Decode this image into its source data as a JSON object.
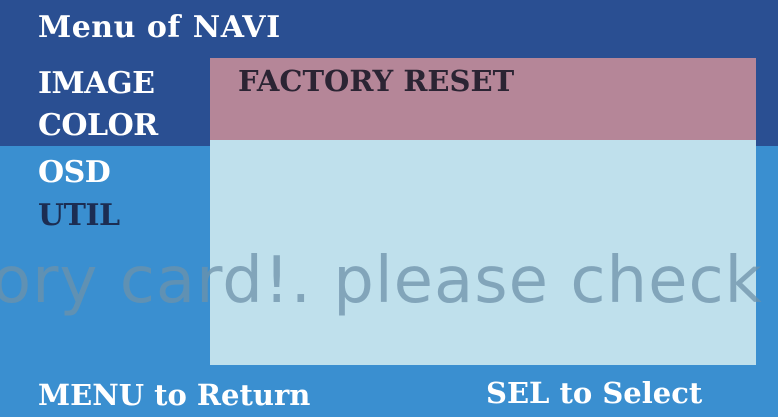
{
  "osd": {
    "title_prefix": "Menu of",
    "title_value": "NAVI",
    "menu_items": [
      {
        "label": "IMAGE",
        "state": "highlighted"
      },
      {
        "label": "COLOR",
        "state": "highlighted"
      },
      {
        "label": "OSD",
        "state": "normal"
      },
      {
        "label": "UTIL",
        "state": "dim"
      }
    ],
    "panel": {
      "header_label": "FACTORY RESET"
    },
    "background_message": "ory card!. please check ar",
    "footer": {
      "left_hint": "MENU to Return",
      "right_hint": "SEL to Select"
    }
  },
  "colors": {
    "top_band": "#2a4f92",
    "screen_background": "#3a8fd0",
    "panel_header": "#b58698",
    "panel_body": "#bfe0ec",
    "text_primary": "#ffffff",
    "text_dim": "#1c2d52"
  }
}
